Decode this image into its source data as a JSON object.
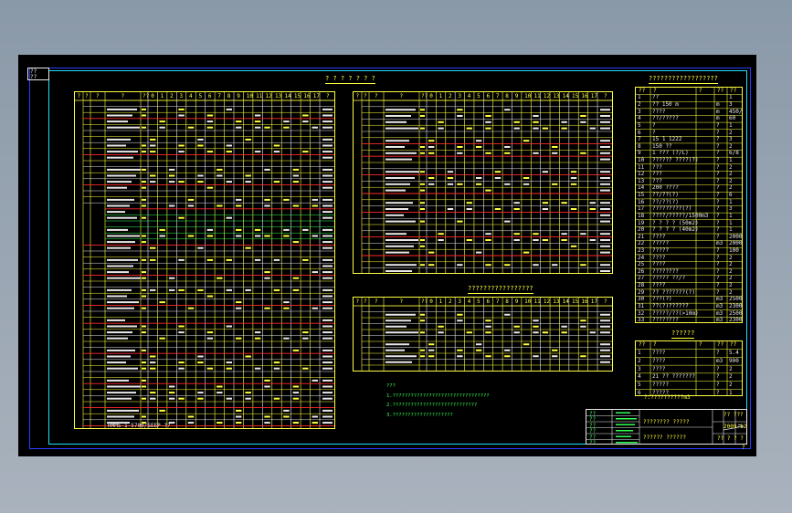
{
  "corner_box": [
    "??",
    "??"
  ],
  "panel_a": {
    "headers": [
      "?",
      "?",
      "?",
      "?",
      "??",
      "0",
      "1",
      "2",
      "3",
      "4",
      "5",
      "6",
      "7",
      "8",
      "9",
      "10",
      "11",
      "12",
      "13",
      "14",
      "15",
      "16",
      "17",
      "?"
    ],
    "bottom_label": "HMMS-1-5700/SEEP-??"
  },
  "panel_b": {
    "title": "? ? ? ? ? ? ?",
    "headers": [
      "?",
      "?",
      "?",
      "?",
      "??",
      "0",
      "1",
      "2",
      "3",
      "4",
      "5",
      "6",
      "7",
      "8",
      "9",
      "10",
      "11",
      "12",
      "13",
      "14",
      "15",
      "16",
      "17",
      "?"
    ]
  },
  "panel_c": {
    "title": "?????????????????",
    "headers": [
      "?",
      "?",
      "?",
      "?",
      "??",
      "0",
      "1",
      "2",
      "3",
      "4",
      "5",
      "6",
      "7",
      "8",
      "9",
      "10",
      "11",
      "12",
      "13",
      "14",
      "15",
      "16",
      "17",
      "?"
    ]
  },
  "notes": [
    "???",
    "1.????????????????????????????????",
    "2.????????????????????????????",
    "3.????????????????????"
  ],
  "right_table": {
    "title": "??????????????????",
    "headers": [
      "??",
      "?",
      "?",
      "??",
      "??"
    ],
    "rows": [
      [
        "1",
        "??",
        "",
        "",
        "1"
      ],
      [
        "2",
        "?? 150 m",
        "",
        "m",
        "3"
      ],
      [
        "3",
        "????",
        "",
        "m",
        "450/2"
      ],
      [
        "4",
        "??/?????",
        "",
        "m",
        "60"
      ],
      [
        "5",
        "?",
        "",
        "?",
        "1"
      ],
      [
        "6",
        "?",
        "",
        "?",
        "2"
      ],
      [
        "7",
        "15 1 1222",
        "",
        "?",
        "3"
      ],
      [
        "8",
        "150 ??",
        "",
        "?",
        "2"
      ],
      [
        "9",
        "1 ??? (?/L)",
        "",
        "?",
        "6/8"
      ],
      [
        "10",
        "?????? ????(?)",
        "",
        "?",
        "1"
      ],
      [
        "11",
        "???",
        "",
        "?",
        "2"
      ],
      [
        "12",
        "???",
        "",
        "?",
        "2"
      ],
      [
        "13",
        "???",
        "",
        "?",
        "2"
      ],
      [
        "14",
        "200 ????",
        "",
        "?",
        "2"
      ],
      [
        "15",
        "??/??(?)",
        "",
        "?",
        "6"
      ],
      [
        "16",
        "??/??(?)",
        "",
        "?",
        "1"
      ],
      [
        "17",
        "?????????(?)",
        "",
        "?",
        "3"
      ],
      [
        "18",
        "????/?????/1500m3",
        "",
        "?",
        "1"
      ],
      [
        "19",
        "? ? ? ? (50m2)",
        "",
        "?",
        "1"
      ],
      [
        "20",
        "? ? ? ? (40m2)",
        "",
        "?",
        "1"
      ],
      [
        "21",
        "????",
        "",
        "?",
        "2000"
      ],
      [
        "22",
        "?????",
        "",
        "m3",
        "2000"
      ],
      [
        "23",
        "?????",
        "",
        "?",
        "100"
      ],
      [
        "24",
        "????",
        "",
        "?",
        "2"
      ],
      [
        "25",
        "????",
        "",
        "?",
        "2"
      ],
      [
        "26",
        "????????",
        "",
        "?",
        "2"
      ],
      [
        "27",
        "????? ??/?",
        "",
        "?",
        "2"
      ],
      [
        "28",
        "????",
        "",
        "?",
        "2"
      ],
      [
        "29",
        "?? ???????(?)",
        "",
        "?",
        "2"
      ],
      [
        "30",
        "???(?)",
        "",
        "m3",
        "2500"
      ],
      [
        "31",
        "??(?)??????",
        "",
        "m3",
        "23000"
      ],
      [
        "32",
        "?????/??(>10m)",
        "",
        "m3",
        "25000"
      ],
      [
        "33",
        "????????",
        "",
        "m3",
        "2300"
      ]
    ]
  },
  "small_table": {
    "title": "??????",
    "headers": [
      "??",
      "?",
      "?",
      "??",
      "??"
    ],
    "rows": [
      [
        "1",
        "????",
        "",
        "?",
        "5.4"
      ],
      [
        "2",
        "????",
        "",
        "m3",
        "900"
      ],
      [
        "3",
        "????",
        "",
        "?",
        "2"
      ],
      [
        "4",
        "21 ?? ???????",
        "",
        "?",
        "2"
      ],
      [
        "5",
        "?????",
        "",
        "?",
        "2"
      ],
      [
        "6",
        "?????",
        "",
        "?",
        "1"
      ]
    ],
    "footnote": "?:??????????m3"
  },
  "title_block": {
    "left_labels": [
      "??",
      "??",
      "??",
      "??",
      "??",
      "??"
    ],
    "center_top": "???????? ?????",
    "center_bottom": "??????    ??????",
    "right_top": "?? ???",
    "right_mid": "2009-12",
    "right_bot": "?? ? ? ? ?",
    "sheet_no": "?"
  },
  "colors": {
    "background": "#8a99a8",
    "sheet": "#000000",
    "line_yellow": "#ffff40",
    "line_white": "#e8e8e8",
    "line_red": "#ff2a2a",
    "line_green": "#33ff55",
    "frame_blue": "#2a3cff",
    "frame_cyan": "#1fe0ff"
  }
}
